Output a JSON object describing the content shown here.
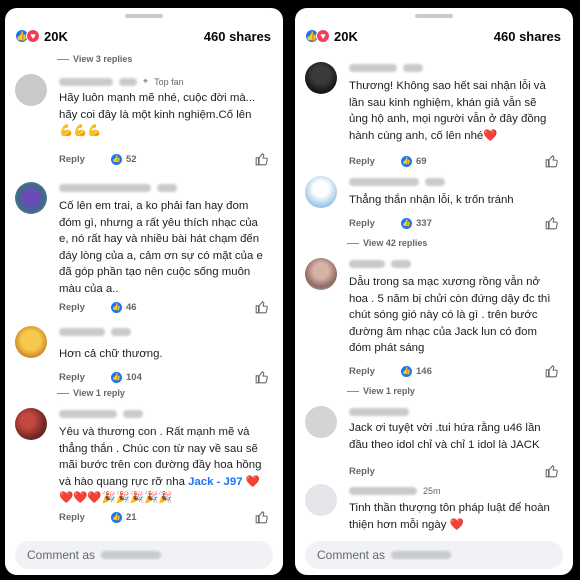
{
  "left": {
    "reactions_count": "20K",
    "shares": "460 shares",
    "view_replies_top": "View 3 replies",
    "comments": [
      {
        "meta": "Top fan",
        "text": "Hãy luôn mạnh mẽ nhé, cuộc đời mà... hãy coi đây là một kinh nghiệm.Cố lên 💪💪💪",
        "reply_label": "Reply",
        "likes": "52"
      },
      {
        "text": "Cố lên em trai, a ko phải fan hay đom đóm gì, nhưng a rất yêu thích nhạc của e, nó rất hay và nhiều bài hát chạm đến đáy lòng của a, cảm ơn sự có mặt của e đã góp phần tạo nên cuộc sống muôn màu của a..",
        "reply_label": "Reply",
        "likes": "46"
      },
      {
        "text": "Hơn cả chữ thương.",
        "reply_label": "Reply",
        "likes": "104"
      },
      {
        "text_pre": "Yêu và thương con . Rất mạnh mẽ và thẳng thắn . Chúc con từ nay về sau sẽ mãi bước trên con đường đầy hoa hồng và hào quang rực rỡ nha ",
        "tag": "Jack - J97",
        "text_post": " ❤️❤️❤️❤️🎉🎉🎉🎉🎉",
        "reply_label": "Reply",
        "likes": "21"
      }
    ],
    "view_reply_mid": "View 1 reply",
    "composer_placeholder": "Comment as"
  },
  "right": {
    "reactions_count": "20K",
    "shares": "460 shares",
    "comments": [
      {
        "text": "Thương! Không sao hết sai nhận lỗi và lần sau kinh nghiệm, khán giả vẫn sẽ ủng hộ anh, mọi người vẫn ở đây đồng hành cùng anh, cố lên nhé❤️",
        "reply_label": "Reply",
        "likes": "69"
      },
      {
        "text": "Thẳng thắn nhận lỗi, k trốn tránh",
        "reply_label": "Reply",
        "likes": "337"
      },
      {
        "text": "Dẫu trong sa mạc xương rồng vẫn nở hoa . 5 năm bị chửi còn đứng dậy đc thì chút sóng gió này có là gì . trên bước đường âm nhạc của Jack lun có đom đóm phát sáng",
        "reply_label": "Reply",
        "likes": "146"
      },
      {
        "text": "Jack ơi tuyệt vời .tui hứa rằng u46 lần đầu theo idol chỉ và chỉ 1 idol là JACK",
        "reply_label": "Reply"
      },
      {
        "meta_time": "25m",
        "text": "Tinh thần thượng tôn pháp luật để hoàn thiện hơn mỗi ngày ❤️"
      }
    ],
    "view_replies_42": "View 42 replies",
    "view_reply_1": "View 1 reply",
    "composer_placeholder": "Comment as"
  },
  "colors": {
    "brand_blue": "#1877f2",
    "love_red": "#f33e58",
    "muted_text": "#65676b"
  },
  "icons": [
    "like-reaction-icon",
    "love-reaction-icon",
    "thumbs-up-icon",
    "top-fan-badge-icon"
  ]
}
